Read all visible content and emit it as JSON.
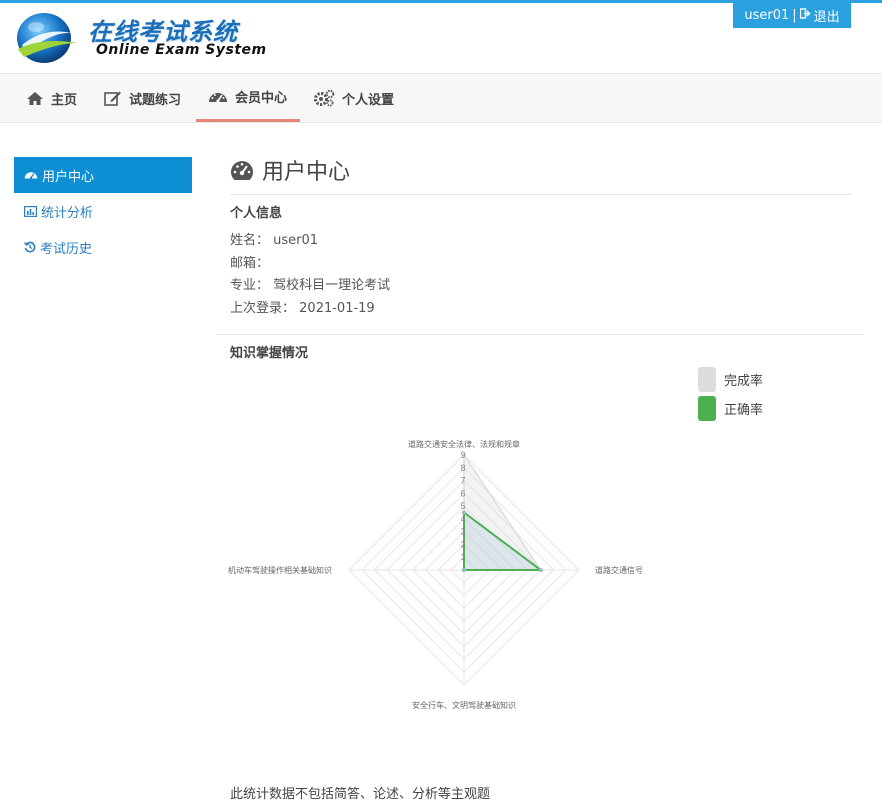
{
  "header": {
    "logo_cn": "在线考试系统",
    "logo_en": "Online Exam System",
    "username": "user01",
    "separator": "|",
    "logout": "退出"
  },
  "nav": [
    {
      "label": "主页",
      "icon": "home-icon"
    },
    {
      "label": "试题练习",
      "icon": "edit-icon"
    },
    {
      "label": "会员中心",
      "icon": "dashboard-icon",
      "active": true
    },
    {
      "label": "个人设置",
      "icon": "gears-icon"
    }
  ],
  "sidebar": [
    {
      "label": "用户中心",
      "icon": "dashboard-icon",
      "active": true
    },
    {
      "label": "统计分析",
      "icon": "bar-chart-icon"
    },
    {
      "label": "考试历史",
      "icon": "history-icon"
    }
  ],
  "main": {
    "title": "用户中心",
    "personal_info_title": "个人信息",
    "info": [
      {
        "label": "姓名：",
        "value": "user01"
      },
      {
        "label": "邮箱：",
        "value": ""
      },
      {
        "label": "专业：",
        "value": "驾校科目一理论考试"
      },
      {
        "label": "上次登录：",
        "value": "2021-01-19"
      }
    ],
    "knowledge_title": "知识掌握情况",
    "footer_note": "此统计数据不包括简答、论述、分析等主观题"
  },
  "colors": {
    "accent": "#2aa0de",
    "sidebar_active": "#0e8fd3",
    "nav_active_underline": "#e8857a",
    "completion": "#dddddd",
    "accuracy": "#4caf50"
  },
  "chart_data": {
    "type": "radar",
    "axes": [
      "道路交通安全法律、法规和规章",
      "道路交通信号",
      "安全行车、文明驾驶基础知识",
      "机动车驾驶操作相关基础知识"
    ],
    "ticks": [
      1,
      2,
      3,
      4,
      5,
      6,
      7,
      8,
      9
    ],
    "range": [
      0,
      9
    ],
    "series": [
      {
        "name": "完成率",
        "values": [
          9,
          6,
          0,
          0
        ],
        "color": "#dddddd"
      },
      {
        "name": "正确率",
        "values": [
          4.5,
          6,
          0,
          0
        ],
        "color": "#4caf50"
      }
    ],
    "legend_position": "top-right"
  }
}
